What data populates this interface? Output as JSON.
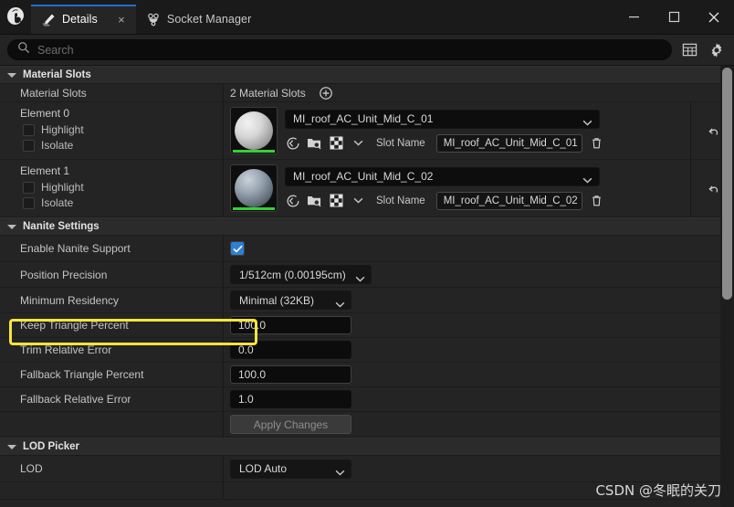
{
  "window": {
    "app_icon": "unreal-engine-logo",
    "minimize_label": "–",
    "maximize_label": "□",
    "close_label": "×"
  },
  "tabs": [
    {
      "label": "Details",
      "icon": "details-pencil-icon",
      "active": true,
      "closable": true,
      "close_label": "×"
    },
    {
      "label": "Socket Manager",
      "icon": "socket-manager-icon",
      "active": false,
      "closable": false
    }
  ],
  "search": {
    "placeholder": "Search",
    "value": "",
    "icon": "search-icon"
  },
  "toolbar": {
    "column_view_icon": "table-columns-icon",
    "settings_icon": "gear-icon"
  },
  "sections": [
    {
      "name": "material-slots",
      "title": "Material Slots",
      "expanded": true
    },
    {
      "name": "nanite-settings",
      "title": "Nanite Settings",
      "expanded": true
    },
    {
      "name": "lod-picker",
      "title": "LOD Picker",
      "expanded": true
    }
  ],
  "material_slots": {
    "row_label": "Material Slots",
    "count_text": "2 Material Slots",
    "add_icon": "plus-circle-icon",
    "elements": [
      {
        "title": "Element 0",
        "highlight_label": "Highlight",
        "highlight_checked": false,
        "isolate_label": "Isolate",
        "isolate_checked": false,
        "material": "MI_roof_AC_Unit_Mid_C_01",
        "slot_name_label": "Slot Name",
        "slot_name_value": "MI_roof_AC_Unit_Mid_C_01",
        "thumbnail_color": "#cfcfcf",
        "thumbnail_accent": "#36d03a",
        "icons": [
          "use-selected-asset-icon",
          "browse-to-asset-icon",
          "checkerboard-icon",
          "chevron-down-icon",
          "delete-trash-icon"
        ],
        "reset_icon": "reset-arrow-icon"
      },
      {
        "title": "Element 1",
        "highlight_label": "Highlight",
        "highlight_checked": false,
        "isolate_label": "Isolate",
        "isolate_checked": false,
        "material": "MI_roof_AC_Unit_Mid_C_02",
        "slot_name_label": "Slot Name",
        "slot_name_value": "MI_roof_AC_Unit_Mid_C_02",
        "thumbnail_color": "#8a94a0",
        "thumbnail_accent": "#36d03a",
        "icons": [
          "use-selected-asset-icon",
          "browse-to-asset-icon",
          "checkerboard-icon",
          "chevron-down-icon",
          "delete-trash-icon"
        ],
        "reset_icon": "reset-arrow-icon"
      }
    ]
  },
  "nanite": {
    "enable_label": "Enable Nanite Support",
    "enable_checked": true,
    "highlight_color": "#f7e53b",
    "position_precision_label": "Position Precision",
    "position_precision_value": "1/512cm (0.00195cm)",
    "minimum_residency_label": "Minimum Residency",
    "minimum_residency_value": "Minimal (32KB)",
    "keep_triangle_percent_label": "Keep Triangle Percent",
    "keep_triangle_percent_value": "100.0",
    "trim_relative_error_label": "Trim Relative Error",
    "trim_relative_error_value": "0.0",
    "fallback_triangle_percent_label": "Fallback Triangle Percent",
    "fallback_triangle_percent_value": "100.0",
    "fallback_relative_error_label": "Fallback Relative Error",
    "fallback_relative_error_value": "1.0",
    "apply_changes_label": "Apply Changes"
  },
  "lod": {
    "label": "LOD",
    "value": "LOD Auto"
  },
  "watermark": {
    "text": "CSDN @冬眠的关刀"
  }
}
